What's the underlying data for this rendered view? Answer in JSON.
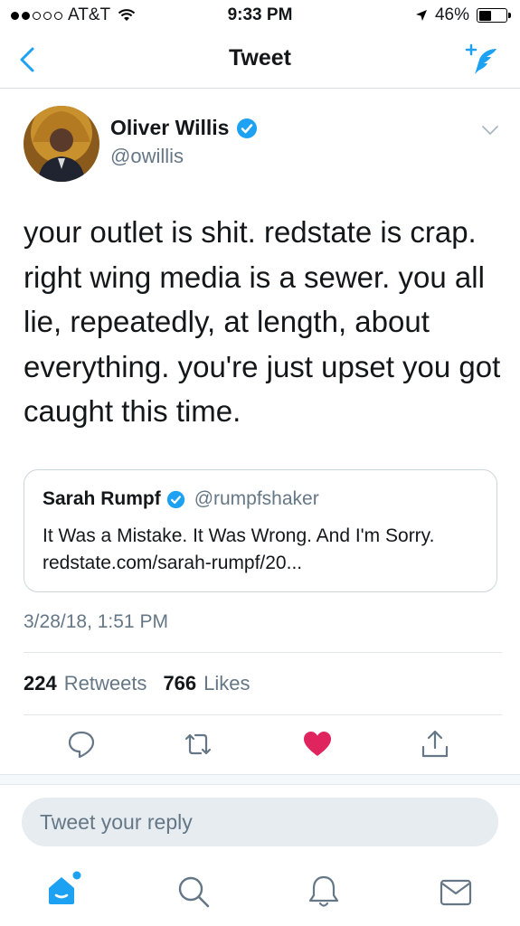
{
  "status_bar": {
    "carrier": "AT&T",
    "time": "9:33 PM",
    "battery": "46%",
    "battery_level": 0.46
  },
  "nav": {
    "title": "Tweet"
  },
  "tweet": {
    "author_name": "Oliver Willis",
    "author_handle": "@owillis",
    "text": "your outlet is shit. redstate is crap. right wing media is a sewer. you all lie, repeatedly, at length, about everything. you're just upset you got caught this time.",
    "timestamp": "3/28/18, 1:51 PM",
    "retweets_count": "224",
    "retweets_label": "Retweets",
    "likes_count": "766",
    "likes_label": "Likes"
  },
  "quote": {
    "name": "Sarah Rumpf",
    "handle": "@rumpfshaker",
    "text": "It Was a Mistake. It Was Wrong. And I'm Sorry. redstate.com/sarah-rumpf/20..."
  },
  "reply": {
    "placeholder": "Tweet your reply"
  },
  "colors": {
    "accent": "#1da1f2",
    "like": "#e0245e",
    "muted": "#657786"
  },
  "icons": [
    "back-chevron-icon",
    "compose-tweet-icon",
    "verified-badge-icon",
    "caret-down-icon",
    "reply-icon",
    "retweet-icon",
    "like-heart-icon",
    "share-icon",
    "home-icon",
    "search-icon",
    "notifications-bell-icon",
    "messages-envelope-icon"
  ]
}
